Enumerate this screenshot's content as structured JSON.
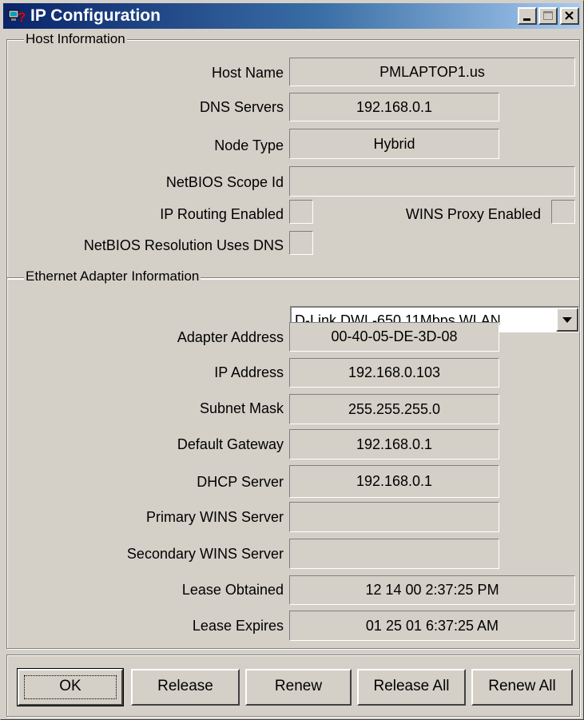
{
  "window": {
    "title": "IP Configuration"
  },
  "host_group": {
    "legend": "Host Information",
    "host_name_label": "Host Name",
    "host_name_value": "PMLAPTOP1.us",
    "dns_servers_label": "DNS Servers",
    "dns_servers_value": "192.168.0.1",
    "node_type_label": "Node Type",
    "node_type_value": "Hybrid",
    "netbios_scope_label": "NetBIOS Scope Id",
    "netbios_scope_value": "",
    "ip_routing_label": "IP Routing Enabled",
    "wins_proxy_label": "WINS Proxy Enabled",
    "netbios_dns_label": "NetBIOS Resolution Uses DNS"
  },
  "adapter_group": {
    "legend": "Ethernet  Adapter Information",
    "selected_adapter": "D-Link DWL-650 11Mbps WLAN",
    "adapter_address_label": "Adapter Address",
    "adapter_address_value": "00-40-05-DE-3D-08",
    "ip_address_label": "IP Address",
    "ip_address_value": "192.168.0.103",
    "subnet_mask_label": "Subnet Mask",
    "subnet_mask_value": "255.255.255.0",
    "default_gateway_label": "Default Gateway",
    "default_gateway_value": "192.168.0.1",
    "dhcp_server_label": "DHCP Server",
    "dhcp_server_value": "192.168.0.1",
    "primary_wins_label": "Primary WINS Server",
    "primary_wins_value": "",
    "secondary_wins_label": "Secondary WINS Server",
    "secondary_wins_value": "",
    "lease_obtained_label": "Lease Obtained",
    "lease_obtained_value": "12 14 00 2:37:25 PM",
    "lease_expires_label": "Lease Expires",
    "lease_expires_value": "01 25 01 6:37:25 AM"
  },
  "buttons": {
    "ok": "OK",
    "release": "Release",
    "renew": "Renew",
    "release_all": "Release All",
    "renew_all": "Renew All"
  },
  "icons": {
    "app": "network-help-icon",
    "minimize": "minimize-icon",
    "maximize": "maximize-icon",
    "close": "close-icon",
    "dropdown": "dropdown-arrow-icon"
  },
  "colors": {
    "titlebar_start": "#0a246a",
    "titlebar_end": "#a6caf0",
    "face": "#d4d0c8"
  }
}
